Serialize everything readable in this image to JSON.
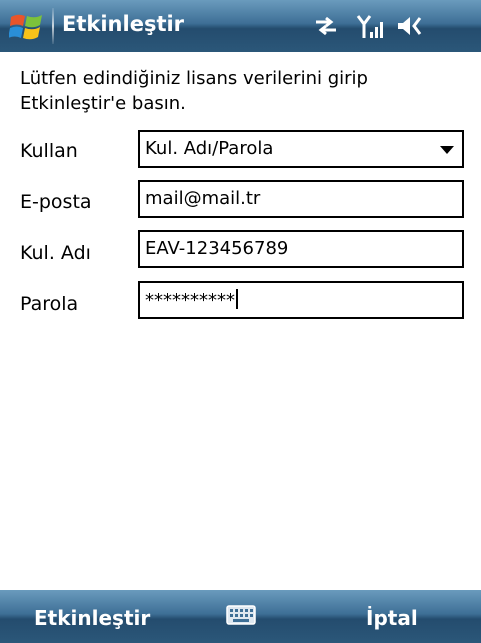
{
  "titlebar": {
    "title": "Etkinleştir",
    "icons": [
      "windows-start-icon",
      "connectivity-icon",
      "signal-icon",
      "volume-icon"
    ]
  },
  "form": {
    "instructions": "Lütfen edindiğiniz lisans verilerini girip Etkinleştir'e basın.",
    "fields": [
      {
        "label": "Kullan",
        "value": "Kul. Adı/Parola",
        "type": "dropdown"
      },
      {
        "label": "E-posta",
        "value": "mail@mail.tr",
        "type": "text"
      },
      {
        "label": "Kul. Adı",
        "value": "EAV-123456789",
        "type": "text"
      },
      {
        "label": "Parola",
        "value": "**********",
        "type": "password"
      }
    ]
  },
  "softkeys": {
    "left": "Etkinleştir",
    "center_icon": "keyboard-icon",
    "right": "İptal"
  },
  "colors": {
    "bar_top": "#6a9bbd",
    "bar_bottom": "#244c6e",
    "text_on_bar": "#ffffff"
  }
}
